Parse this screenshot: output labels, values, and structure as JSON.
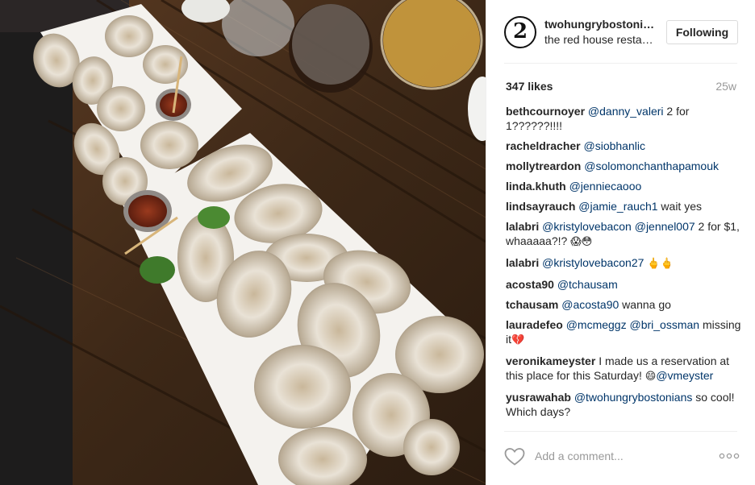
{
  "photo": {
    "alt_icon": "oyster-platter-photo"
  },
  "header": {
    "username": "twohungrybostonians",
    "location": "the red house restaurant",
    "follow_label": "Following",
    "avatar_glyph": "2"
  },
  "stats": {
    "likes": "347 likes",
    "age": "25w"
  },
  "comments": [
    {
      "user": "bethcournoyer",
      "parts": [
        {
          "m": "@danny_valeri"
        },
        {
          "t": " 2 for 1??????!!!!"
        }
      ]
    },
    {
      "user": "racheldracher",
      "parts": [
        {
          "m": "@siobhanlic"
        }
      ]
    },
    {
      "user": "mollytreardon",
      "parts": [
        {
          "m": "@solomonchanthapamouk"
        }
      ]
    },
    {
      "user": "linda.khuth",
      "parts": [
        {
          "m": "@jenniecaooo"
        }
      ]
    },
    {
      "user": "lindsayrauch",
      "parts": [
        {
          "m": "@jamie_rauch1"
        },
        {
          "t": " wait yes"
        }
      ]
    },
    {
      "user": "lalabri",
      "parts": [
        {
          "m": "@kristylovebacon"
        },
        {
          "t": " "
        },
        {
          "m": "@jennel007"
        },
        {
          "t": " 2 for $1, whaaaaa?!? "
        },
        {
          "e": "😱😳"
        }
      ]
    },
    {
      "user": "lalabri",
      "parts": [
        {
          "m": "@kristylovebacon27"
        },
        {
          "t": " "
        },
        {
          "e": "🖕🖕"
        }
      ]
    },
    {
      "user": "acosta90",
      "parts": [
        {
          "m": "@tchausam"
        }
      ]
    },
    {
      "user": "tchausam",
      "parts": [
        {
          "m": "@acosta90"
        },
        {
          "t": " wanna go"
        }
      ]
    },
    {
      "user": "laurадefeo",
      "parts": [
        {
          "m": "@mcmeggz"
        },
        {
          "t": " "
        },
        {
          "m": "@bri_ossman"
        },
        {
          "t": " missing it"
        },
        {
          "e": "💔"
        }
      ]
    },
    {
      "user": "veronikameyster",
      "parts": [
        {
          "t": "I made us a reservation at this place for this Saturday! "
        },
        {
          "e": "😄"
        },
        {
          "m": "@vmeyster"
        }
      ]
    },
    {
      "user": "yusrawahab",
      "parts": [
        {
          "m": "@twohungrybostonians"
        },
        {
          "t": " so cool! Which days?"
        }
      ]
    }
  ],
  "compose": {
    "placeholder": "Add a comment..."
  },
  "icons": {
    "like": "heart-icon",
    "options": "more-options-icon"
  },
  "colors": {
    "mention": "#003569",
    "muted": "#999999",
    "border": "#efefef"
  }
}
